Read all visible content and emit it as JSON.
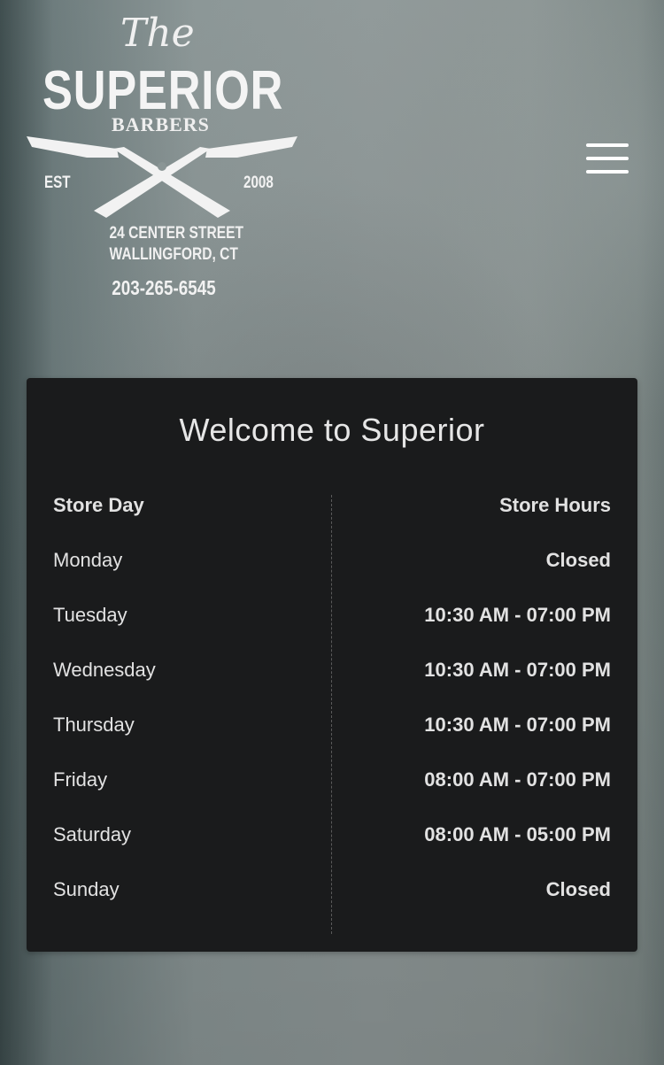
{
  "logo": {
    "the": "The",
    "name": "SUPERIOR",
    "sub": "BARBERS",
    "est": "EST",
    "year": "2008",
    "address_line1": "24 CENTER STREET",
    "address_line2": "WALLINGFORD, CT",
    "phone": "203-265-6545"
  },
  "menu": {
    "icon": "hamburger-menu-icon"
  },
  "card": {
    "title": "Welcome to Superior",
    "header": {
      "day": "Store Day",
      "hours": "Store Hours"
    },
    "rows": [
      {
        "day": "Monday",
        "hours": "Closed"
      },
      {
        "day": "Tuesday",
        "hours": "10:30 AM - 07:00 PM"
      },
      {
        "day": "Wednesday",
        "hours": "10:30 AM - 07:00 PM"
      },
      {
        "day": "Thursday",
        "hours": "10:30 AM - 07:00 PM"
      },
      {
        "day": "Friday",
        "hours": "08:00 AM - 07:00 PM"
      },
      {
        "day": "Saturday",
        "hours": "08:00 AM - 05:00 PM"
      },
      {
        "day": "Sunday",
        "hours": "Closed"
      }
    ]
  },
  "colors": {
    "card_bg": "#1a1b1c",
    "text": "#e2e2e2",
    "logo": "#f2f2f2"
  }
}
